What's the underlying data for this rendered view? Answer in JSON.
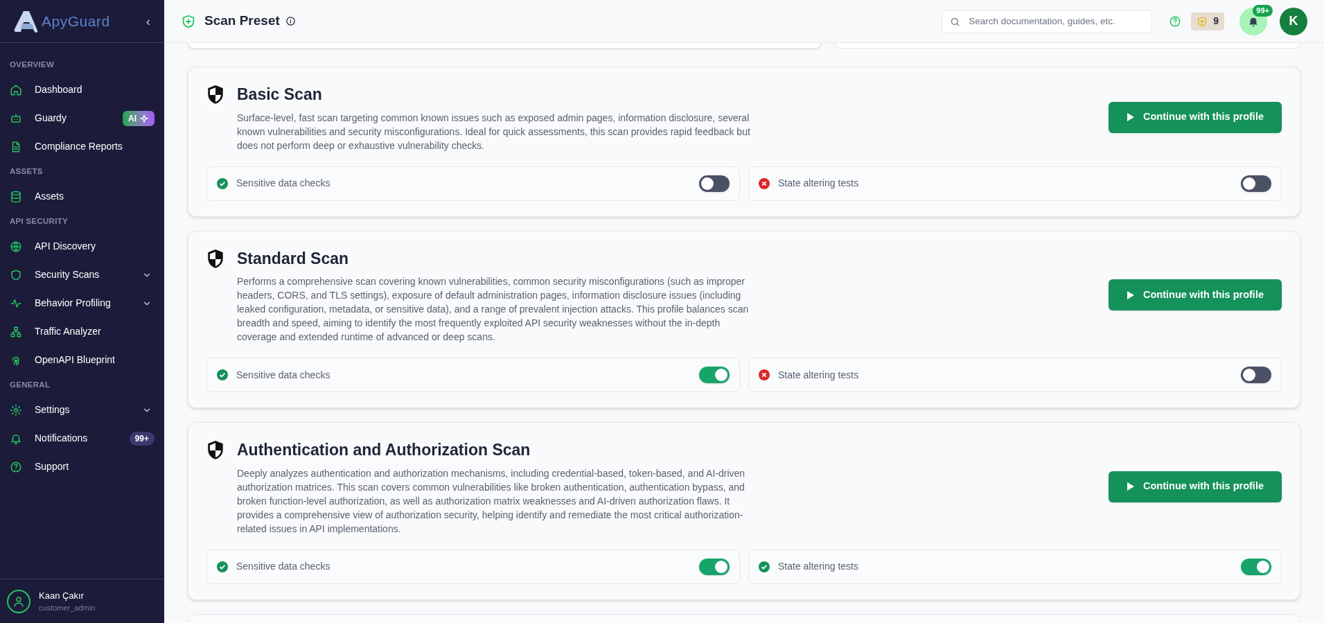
{
  "sidebar": {
    "brand": "ApyGuard",
    "collapse_glyph": "‹",
    "sections": [
      {
        "heading": "OVERVIEW",
        "items": [
          {
            "label": "Dashboard",
            "expandable": false
          },
          {
            "label": "Guardy",
            "badge": {
              "text": "AI",
              "kind": "ai"
            },
            "expandable": false
          },
          {
            "label": "Compliance Reports",
            "expandable": false
          }
        ]
      },
      {
        "heading": "ASSETS",
        "items": [
          {
            "label": "Assets",
            "expandable": false
          }
        ]
      },
      {
        "heading": "API SECURITY",
        "items": [
          {
            "label": "API Discovery",
            "expandable": false
          },
          {
            "label": "Security Scans",
            "expandable": true
          },
          {
            "label": "Behavior Profiling",
            "expandable": true
          },
          {
            "label": "Traffic Analyzer",
            "expandable": false
          },
          {
            "label": "OpenAPI Blueprint",
            "expandable": false
          }
        ]
      },
      {
        "heading": "GENERAL",
        "items": [
          {
            "label": "Settings",
            "expandable": true
          },
          {
            "label": "Notifications",
            "badge": {
              "text": "99+",
              "kind": "count"
            },
            "expandable": false
          },
          {
            "label": "Support",
            "expandable": false
          }
        ]
      }
    ],
    "user": {
      "name": "Kaan Çakır",
      "role": "customer_admin"
    }
  },
  "header": {
    "title": "Scan Preset",
    "search": {
      "placeholder": "Search documentation, guides, etc."
    },
    "credits": "9",
    "notifications_badge": "99+",
    "avatar_initial": "K"
  },
  "profiles": [
    {
      "title": "Basic Scan",
      "description": "Surface-level, fast scan targeting common known issues such as exposed admin pages, information disclosure, several known vulnerabilities and security misconfigurations. Ideal for quick assessments, this scan provides rapid feedback but does not perform deep or exhaustive vulnerability checks.",
      "button": "Continue with this profile",
      "options": [
        {
          "label": "Sensitive data checks",
          "allowed": true,
          "on": false
        },
        {
          "label": "State altering tests",
          "allowed": false,
          "on": false
        }
      ]
    },
    {
      "title": "Standard Scan",
      "description": "Performs a comprehensive scan covering known vulnerabilities, common security misconfigurations (such as improper headers, CORS, and TLS settings), exposure of default administration pages, information disclosure issues (including leaked configuration, metadata, or sensitive data), and a range of prevalent injection attacks. This profile balances scan breadth and speed, aiming to identify the most frequently exploited API security weaknesses without the in-depth coverage and extended runtime of advanced or deep scans.",
      "button": "Continue with this profile",
      "options": [
        {
          "label": "Sensitive data checks",
          "allowed": true,
          "on": true
        },
        {
          "label": "State altering tests",
          "allowed": false,
          "on": false
        }
      ]
    },
    {
      "title": "Authentication and Authorization Scan",
      "description": "Deeply analyzes authentication and authorization mechanisms, including credential-based, token-based, and AI-driven authorization matrices. This scan covers common vulnerabilities like broken authentication, authentication bypass, and broken function-level authorization, as well as authorization matrix weaknesses and AI-driven authorization flaws. It provides a comprehensive view of authorization security, helping identify and remediate the most critical authorization-related issues in API implementations.",
      "button": "Continue with this profile",
      "options": [
        {
          "label": "Sensitive data checks",
          "allowed": true,
          "on": true
        },
        {
          "label": "State altering tests",
          "allowed": true,
          "on": true
        }
      ]
    }
  ]
}
